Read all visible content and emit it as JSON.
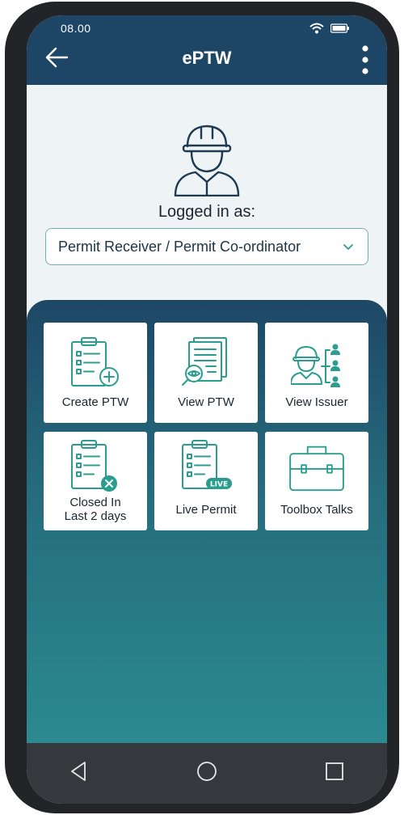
{
  "status_bar": {
    "time": "08.00",
    "wifi_icon": "wifi-icon",
    "battery_icon": "battery-icon"
  },
  "header": {
    "title": "ePTW",
    "back_icon": "arrow-left-icon",
    "menu_icon": "more-vertical-icon"
  },
  "login": {
    "label": "Logged in as:",
    "role_value": "Permit Receiver / Permit Co-ordinator",
    "avatar_icon": "worker-helmet-icon"
  },
  "tiles": [
    {
      "label": "Create PTW",
      "icon": "clipboard-add-icon"
    },
    {
      "label": "View PTW",
      "icon": "document-view-icon"
    },
    {
      "label": "View Issuer",
      "icon": "worker-hierarchy-icon"
    },
    {
      "label": "Closed In\nLast 2 days",
      "icon": "clipboard-closed-icon"
    },
    {
      "label": "Live Permit",
      "icon": "clipboard-live-icon",
      "badge": "LIVE"
    },
    {
      "label": "Toolbox Talks",
      "icon": "toolbox-icon"
    }
  ],
  "nav": {
    "back": "nav-back-icon",
    "home": "nav-home-icon",
    "recents": "nav-recents-icon"
  },
  "colors": {
    "header": "#1d4666",
    "accent": "#2b8a90",
    "icon_stroke": "#2a9d8f",
    "screen_bg": "#eef4f5"
  }
}
